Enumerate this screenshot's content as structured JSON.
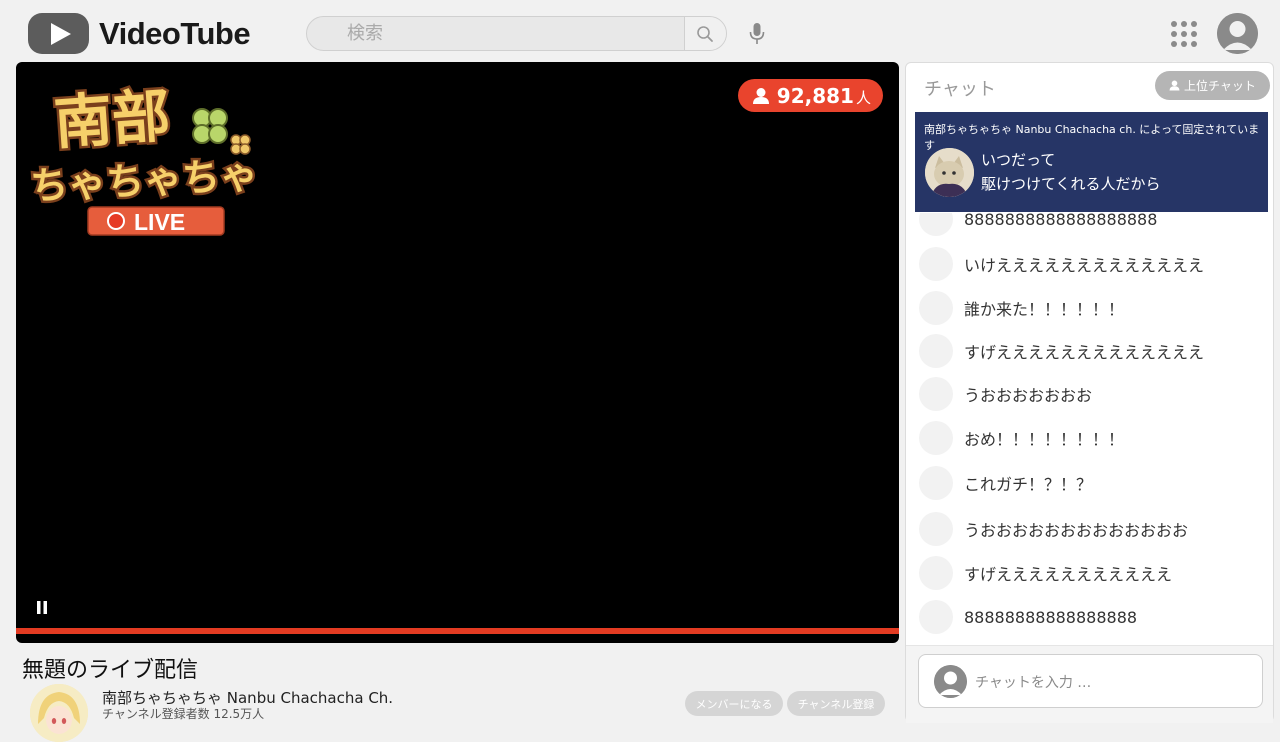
{
  "app": {
    "name": "VideoTube"
  },
  "search": {
    "placeholder": "検索"
  },
  "player": {
    "viewer_count": "92,881",
    "viewer_unit": "人",
    "brand_lines": [
      "南部",
      "ちゃちゃちゃ",
      "LIVE"
    ],
    "progress": 1.0
  },
  "video": {
    "title": "無題のライブ配信",
    "channel_name": "南部ちゃちゃちゃ Nanbu Chachacha Ch.",
    "subscribers": "チャンネル登録者数 12.5万人",
    "member_label": "メンバーになる",
    "subscribe_label": "チャンネル登録"
  },
  "chat": {
    "title": "チャット",
    "top_chat_label": "上位チャット",
    "pinned": {
      "label": "南部ちゃちゃちゃ Nanbu Chachacha ch. によって固定されています",
      "line1": "いつだって",
      "line2": "駆けつけてくれる人だから"
    },
    "messages": [
      "8888888888888888888",
      "いけえええええええええええええ",
      "誰か来た！！！！！！",
      "すげえええええええええええええ",
      "うおおおおおおお",
      "おめ！！！！！！！！",
      "これガチ！？！？",
      "うおおおおおおおおおおおおお",
      "すげえええええええええええ",
      "88888888888888888"
    ],
    "input_placeholder": "チャットを入力 …"
  },
  "colors": {
    "accent_red": "#e9442d",
    "pinned_bg": "#263566",
    "logo_gray": "#5c5c5c"
  }
}
